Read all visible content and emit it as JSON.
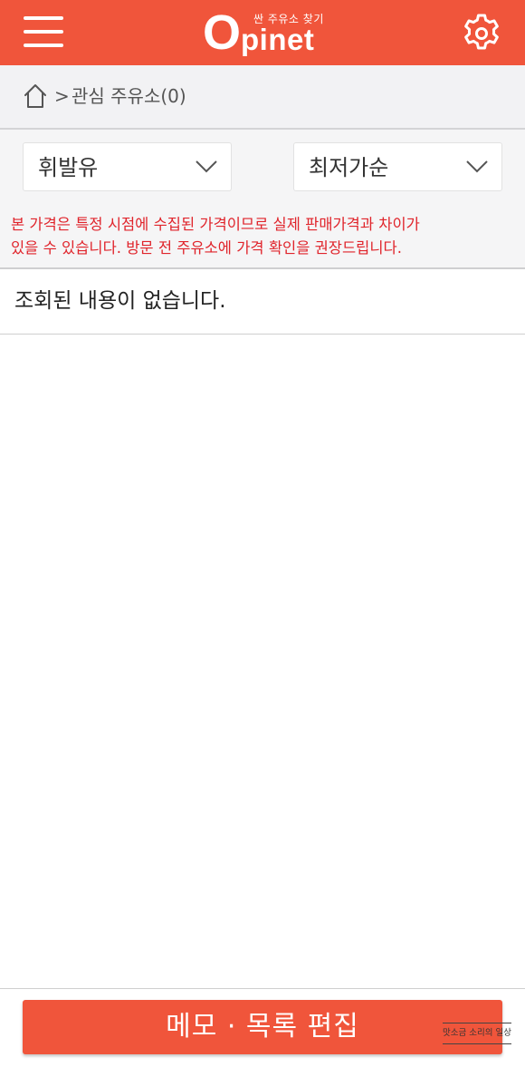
{
  "header": {
    "logo_sub": "싼 주유소 찾기",
    "logo_initial": "O",
    "logo_text": "pinet",
    "menu_icon": "hamburger-menu-icon",
    "settings_icon": "gear-icon"
  },
  "breadcrumb": {
    "home_icon": "home-icon",
    "separator": ">",
    "title": "관심 주유소(0)"
  },
  "filters": {
    "fuel": {
      "selected": "휘발유"
    },
    "sort": {
      "selected": "최저가순"
    },
    "chevron_icon": "chevron-down-icon"
  },
  "notice": {
    "line1": "본 가격은 특정 시점에 수집된 가격이므로 실제 판매가격과 차이가",
    "line2": "있을 수 있습니다. 방문 전 주유소에 가격 확인을 권장드립니다."
  },
  "list": {
    "empty_message": "조회된 내용이 없습니다."
  },
  "footer": {
    "edit_button_label": "메모 · 목록 편집",
    "watermark": "맛소금 소리의 일상"
  },
  "colors": {
    "brand": "#f0553b",
    "notice_red": "#e0242b",
    "breadcrumb_bg": "#f2f2f4"
  }
}
